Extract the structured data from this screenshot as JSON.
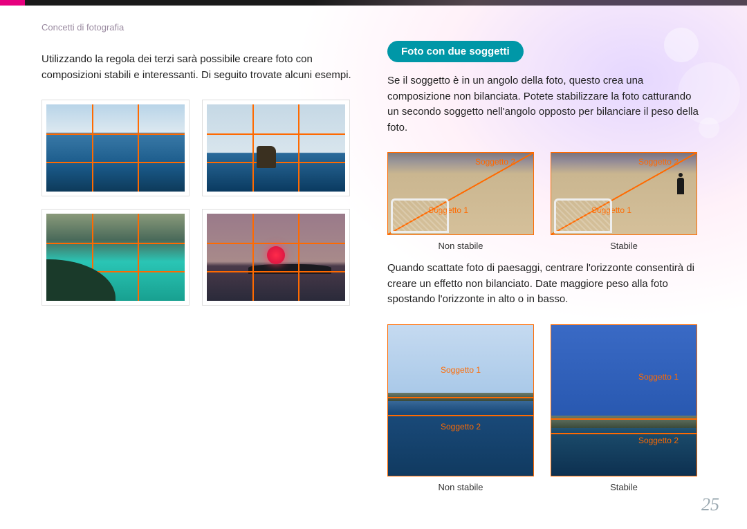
{
  "breadcrumb": "Concetti di fotografia",
  "left": {
    "intro": "Utilizzando la regola dei terzi sarà possibile creare foto con composizioni stabili e interessanti. Di seguito trovate alcuni esempi."
  },
  "right": {
    "pill": "Foto con due soggetti",
    "p1": "Se il soggetto è in un angolo della foto, questo crea una composizione non bilanciata. Potete stabilizzare la foto catturando un secondo soggetto nell'angolo opposto per bilanciare il peso della foto.",
    "p2": "Quando scattate foto di paesaggi, centrare l'orizzonte consentirà di creare un effetto non bilanciato. Date maggiore peso alla foto spostando l'orizzonte in alto o in basso.",
    "labels": {
      "s1": "Soggetto 1",
      "s2": "Soggetto 2"
    },
    "captions": {
      "unstable": "Non stabile",
      "stable": "Stabile"
    }
  },
  "page_number": "25"
}
